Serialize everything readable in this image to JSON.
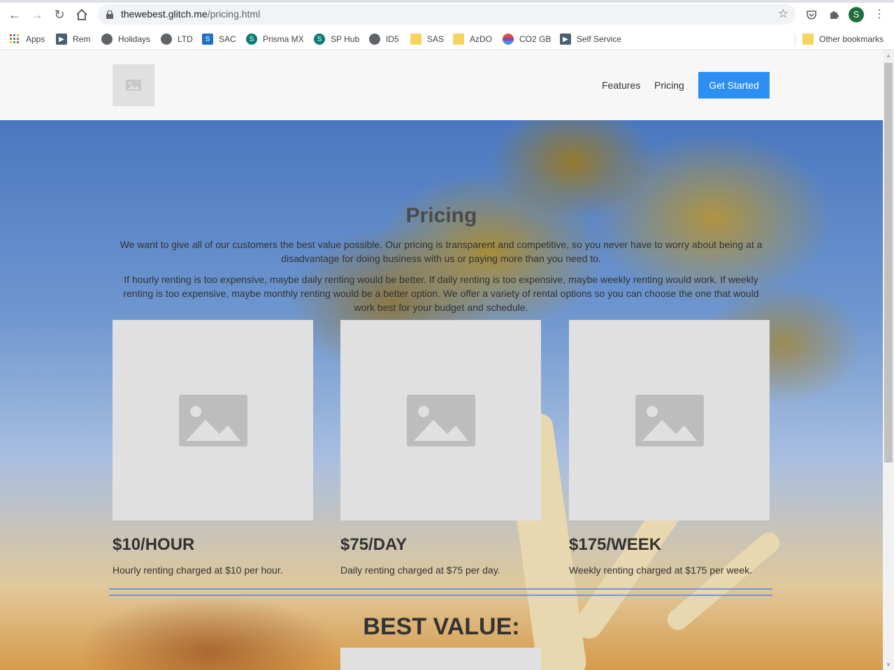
{
  "browser": {
    "url_host": "thewebest.glitch.me",
    "url_path": "/pricing.html",
    "avatar_initial": "S",
    "bookmarks": [
      {
        "label": "Apps",
        "icon": "apps-grid-icon"
      },
      {
        "label": "Rem",
        "icon": "arrow-icon"
      },
      {
        "label": "Holidays",
        "icon": "globe-icon"
      },
      {
        "label": "LTD",
        "icon": "globe-icon"
      },
      {
        "label": "SAC",
        "icon": "sap-icon"
      },
      {
        "label": "Prisma MX",
        "icon": "sharepoint-icon"
      },
      {
        "label": "SP Hub",
        "icon": "sharepoint-icon"
      },
      {
        "label": "ID5",
        "icon": "globe-icon"
      },
      {
        "label": "SAS",
        "icon": "folder-icon"
      },
      {
        "label": "AzDO",
        "icon": "folder-icon"
      },
      {
        "label": "CO2 GB",
        "icon": "co2-icon"
      },
      {
        "label": "Self Service",
        "icon": "arrow-icon"
      }
    ],
    "other_bookmarks": "Other bookmarks"
  },
  "site": {
    "nav": {
      "features": "Features",
      "pricing": "Pricing",
      "cta": "Get Started"
    },
    "hero": {
      "title": "Pricing",
      "para1": "We want to give all of our customers the best value possible. Our pricing is transparent and competitive, so you never have to worry about being at a disadvantage for doing business with us or paying more than you need to.",
      "para2": "If hourly renting is too expensive, maybe daily renting would be better. If daily renting is too expensive, maybe weekly renting would work. If weekly renting is too expensive, maybe monthly renting would be a better option. We offer a variety of rental options so you can choose the one that would work best for your budget and schedule."
    },
    "cards": [
      {
        "price": "$10/HOUR",
        "desc": "Hourly renting charged at $10 per hour."
      },
      {
        "price": "$75/DAY",
        "desc": "Daily renting charged at $75 per day."
      },
      {
        "price": "$175/WEEK",
        "desc": "Weekly renting charged at $175 per week."
      }
    ],
    "best_value": "BEST VALUE:"
  }
}
